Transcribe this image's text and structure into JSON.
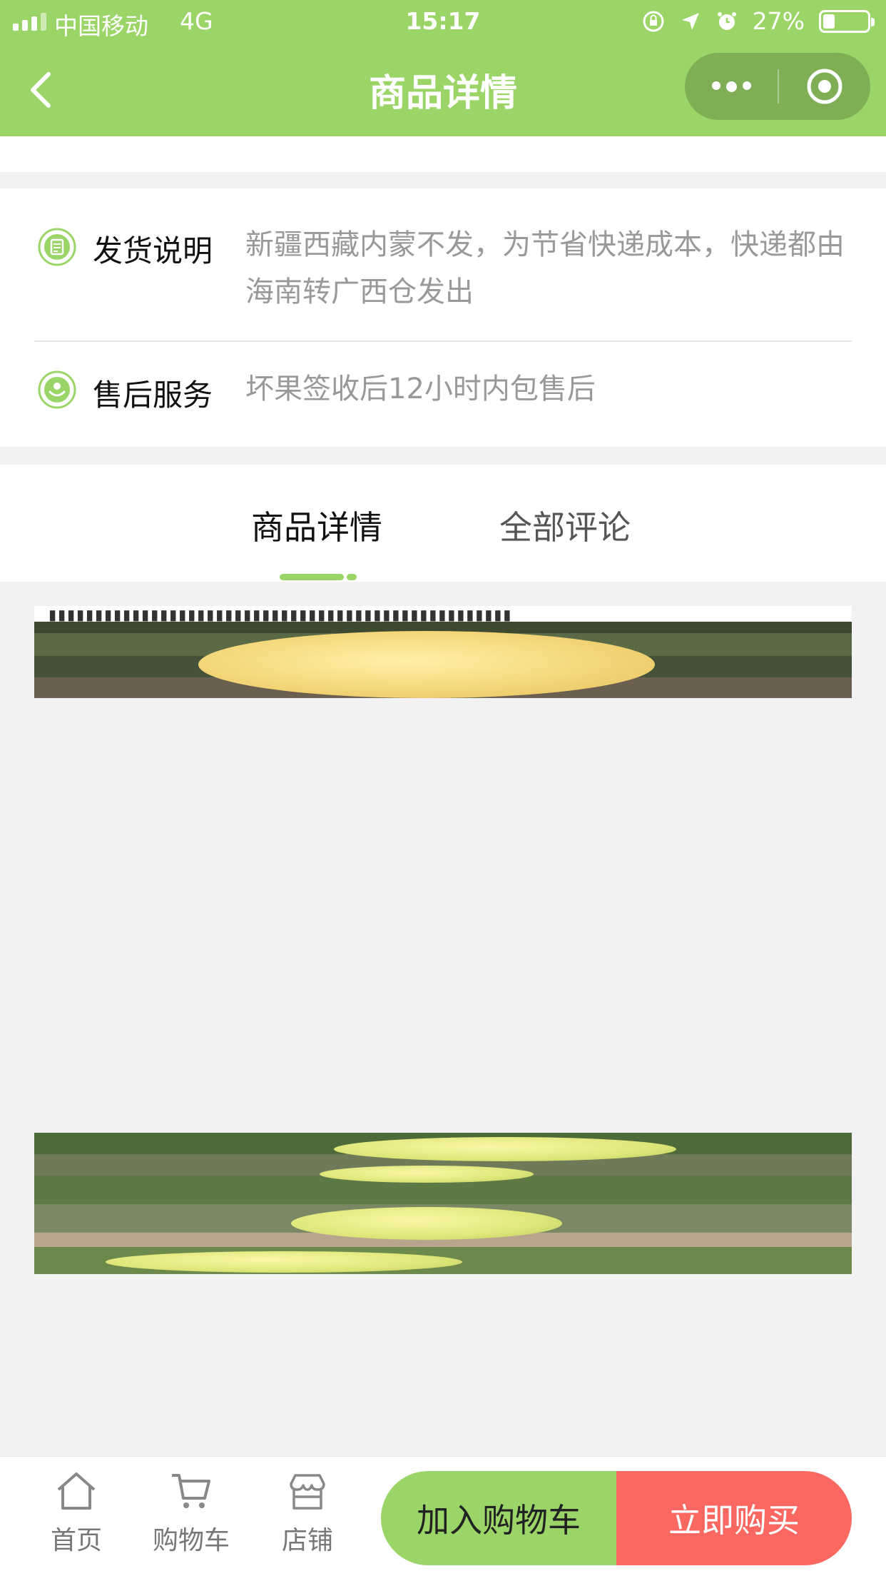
{
  "status_bar": {
    "carrier": "中国移动",
    "network": "4G",
    "time": "15:17",
    "battery": "27%",
    "battery_level": 0.27
  },
  "nav": {
    "title": "商品详情"
  },
  "info": {
    "shipping_label": "发货说明",
    "shipping_text": "新疆西藏内蒙不发，为节省快递成本，快递都由海南转广西仓发出",
    "aftersale_label": "售后服务",
    "aftersale_text": "坏果签收后12小时内包售后"
  },
  "tabs": {
    "details": "商品详情",
    "reviews": "全部评论"
  },
  "bottom": {
    "home": "首页",
    "cart": "购物车",
    "shop": "店铺",
    "add_to_cart": "加入购物车",
    "buy_now": "立即购买"
  },
  "colors": {
    "accent": "#9bd568",
    "buy": "#fb6862"
  }
}
